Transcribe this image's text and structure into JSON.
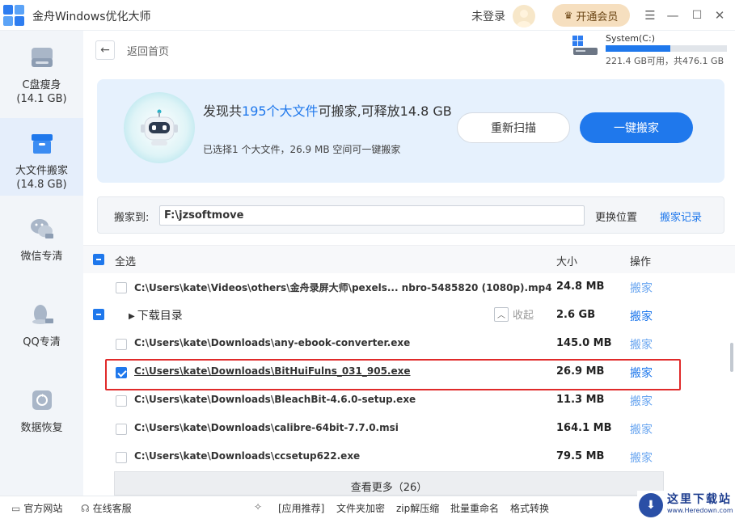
{
  "app": {
    "title": "金舟Windows优化大师",
    "login_text": "未登录",
    "vip_label": "开通会员",
    "controls": {
      "menu": "☰",
      "minimize": "—",
      "maximize": "☐",
      "close": "✕"
    }
  },
  "sidebar": {
    "items": [
      {
        "label": "C盘瘦身",
        "sub": "(14.1 GB)",
        "icon": "drive-icon"
      },
      {
        "label": "大文件搬家",
        "sub": "(14.8 GB)",
        "icon": "box-icon",
        "active": true
      },
      {
        "label": "微信专清",
        "sub": "",
        "icon": "wechat-icon"
      },
      {
        "label": "QQ专清",
        "sub": "",
        "icon": "qq-icon"
      },
      {
        "label": "数据恢复",
        "sub": "",
        "icon": "recovery-icon"
      }
    ]
  },
  "header": {
    "back_label": "返回首页",
    "disk": {
      "name": "System(C:)",
      "info": "221.4 GB可用，共476.1 GB",
      "used_fraction": 0.535
    }
  },
  "banner": {
    "text_pre": "发现共",
    "count_text": "195个大文件",
    "text_post": "可搬家,可释放14.8 GB",
    "subtext": "已选择1 个大文件，26.9 MB 空间可一键搬家",
    "rescan_label": "重新扫描",
    "move_label": "一键搬家"
  },
  "destination": {
    "label": "搬家到:",
    "value": "F:\\jzsoftmove",
    "change_label": "更换位置",
    "history_label": "搬家记录"
  },
  "list": {
    "select_all": "全选",
    "col_size": "大小",
    "col_action": "操作",
    "rows": [
      {
        "path": "C:\\Users\\kate\\Videos\\others\\金舟录屏大师\\pexels... nbro-5485820 (1080p).mp4",
        "size": "24.8 MB",
        "action": "搬家",
        "checked": false
      },
      {
        "path": "C:\\Users\\kate\\Downloads\\any-ebook-converter.exe",
        "size": "145.0 MB",
        "action": "搬家",
        "checked": false
      },
      {
        "path": "C:\\Users\\kate\\Downloads\\BitHuiFulns_031_905.exe",
        "size": "26.9 MB",
        "action": "搬家",
        "checked": true
      },
      {
        "path": "C:\\Users\\kate\\Downloads\\BleachBit-4.6.0-setup.exe",
        "size": "11.3 MB",
        "action": "搬家",
        "checked": false
      },
      {
        "path": "C:\\Users\\kate\\Downloads\\calibre-64bit-7.7.0.msi",
        "size": "164.1 MB",
        "action": "搬家",
        "checked": false
      },
      {
        "path": "C:\\Users\\kate\\Downloads\\ccsetup622.exe",
        "size": "79.5 MB",
        "action": "搬家",
        "checked": false
      }
    ],
    "group": {
      "title": "下载目录",
      "size": "2.6 GB",
      "action": "搬家",
      "collapse_label": "收起"
    },
    "see_more": "查看更多（26）"
  },
  "footer": {
    "website": "官方网站",
    "service": "在线客服",
    "links": [
      "[应用推荐]",
      "文件夹加密",
      "zip解压缩",
      "批量重命名",
      "格式转换"
    ]
  },
  "watermark": {
    "main": "这里下载站",
    "url": "www.Heredown.com"
  },
  "colors": {
    "accent": "#1f78ec",
    "vip": "#f6dfbf",
    "highlight": "#e02a2a",
    "sidebar": "#f2f5f9"
  }
}
